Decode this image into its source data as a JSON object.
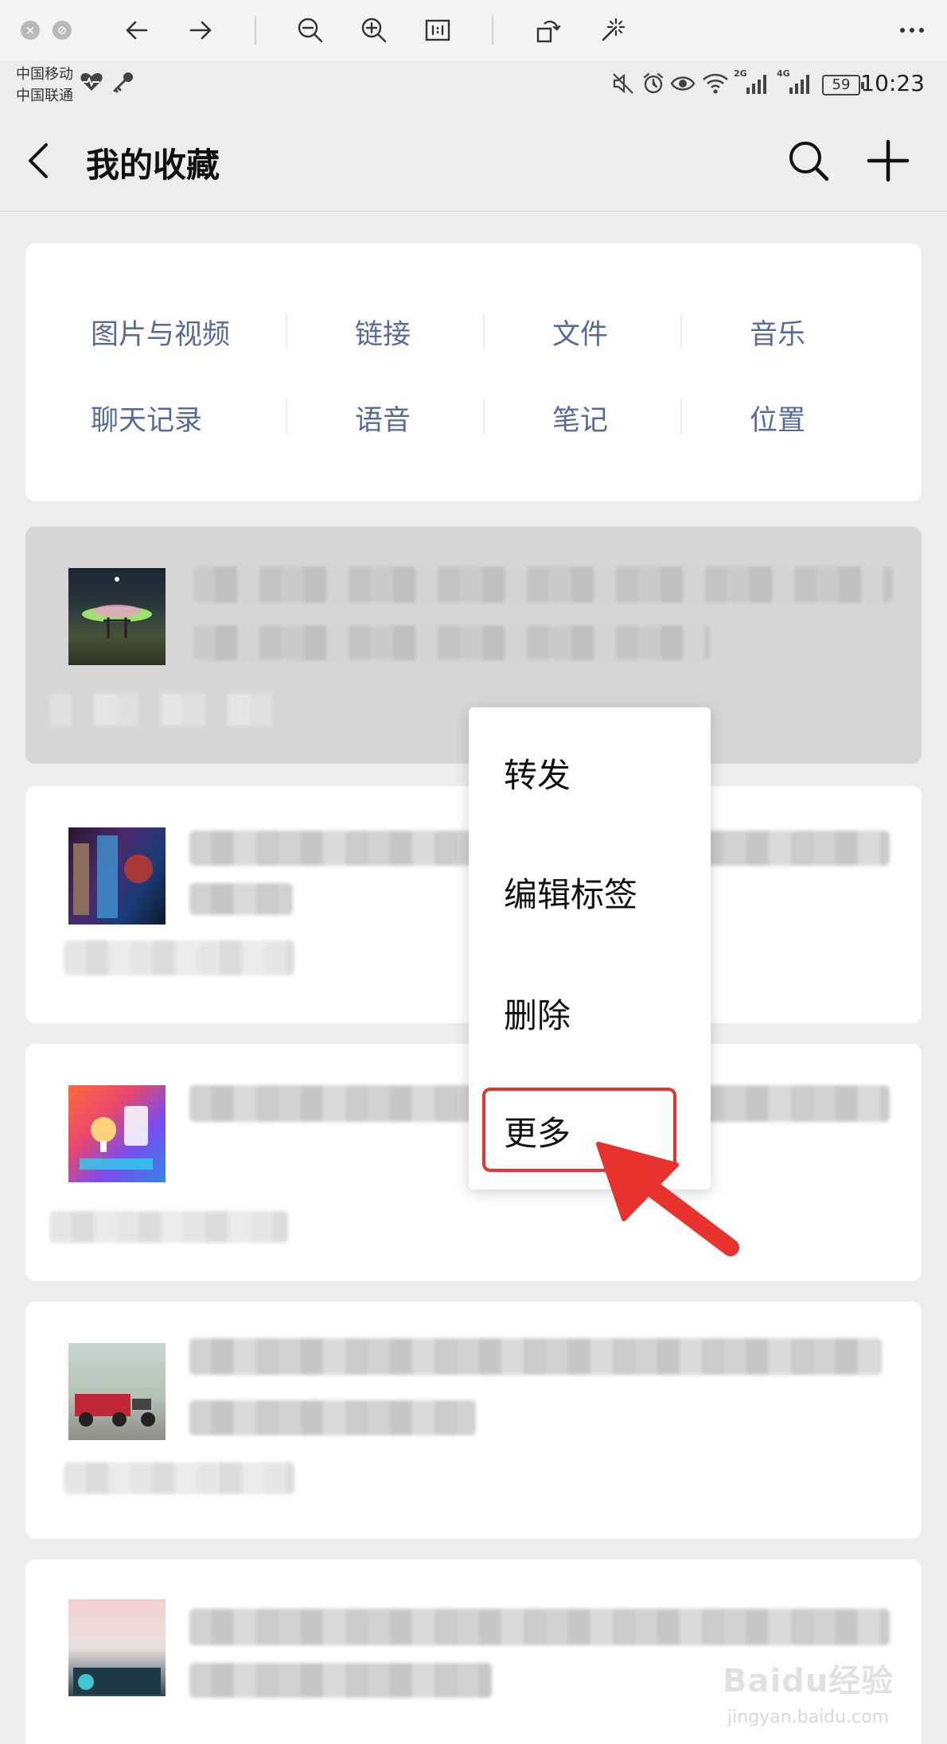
{
  "status_bar": {
    "carriers": [
      "中国移动",
      "中国联通"
    ],
    "battery": "59",
    "time": "10:23",
    "network_labels": [
      "2G",
      "4G"
    ]
  },
  "header": {
    "title": "我的收藏",
    "back_icon": "chevron-left-icon",
    "search_icon": "search-icon",
    "add_icon": "plus-icon"
  },
  "categories": {
    "row1": [
      "图片与视频",
      "链接",
      "文件",
      "音乐"
    ],
    "row2": [
      "聊天记录",
      "语音",
      "笔记",
      "位置"
    ]
  },
  "context_menu": {
    "items": [
      "转发",
      "编辑标签",
      "删除",
      "更多"
    ],
    "highlighted": "更多",
    "highlight_color": "#e8322d"
  },
  "colors": {
    "category_text": "#576b95",
    "background": "#ededed",
    "selected_item": "#d6d6d6"
  },
  "watermark": {
    "logo": "Baidu经验",
    "url": "jingyan.baidu.com"
  }
}
